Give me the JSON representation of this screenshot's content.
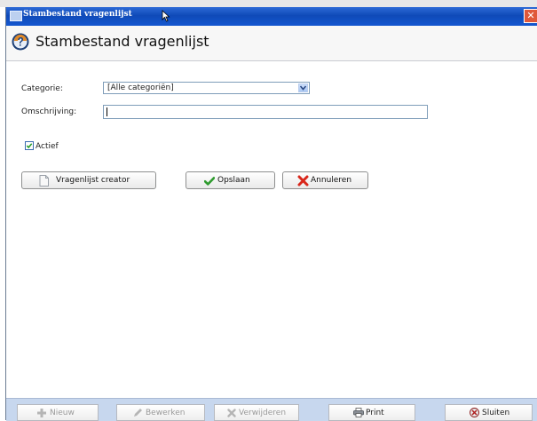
{
  "window": {
    "title": "Stambestand vragenlijst",
    "close_glyph": "✕"
  },
  "header": {
    "title": "Stambestand vragenlijst",
    "icon": "help-question-icon"
  },
  "form": {
    "categorie_label": "Categorie:",
    "categorie_value": "[Alle categoriën]",
    "omschrijving_label": "Omschrijving:",
    "omschrijving_value": "",
    "actief_label": "Actief",
    "actief_checked": true
  },
  "actions": {
    "creator_label": "Vragenlijst creator",
    "save_label": "Opslaan",
    "cancel_label": "Annuleren"
  },
  "footer": {
    "new_label": "Nieuw",
    "edit_label": "Bewerken",
    "delete_label": "Verwijderen",
    "print_label": "Print",
    "close_label": "Sluiten"
  },
  "colors": {
    "titlebar": "#1457d0",
    "footer": "#c7d7ee",
    "save_check": "#2e9b2e",
    "cancel_x": "#d9271b"
  }
}
